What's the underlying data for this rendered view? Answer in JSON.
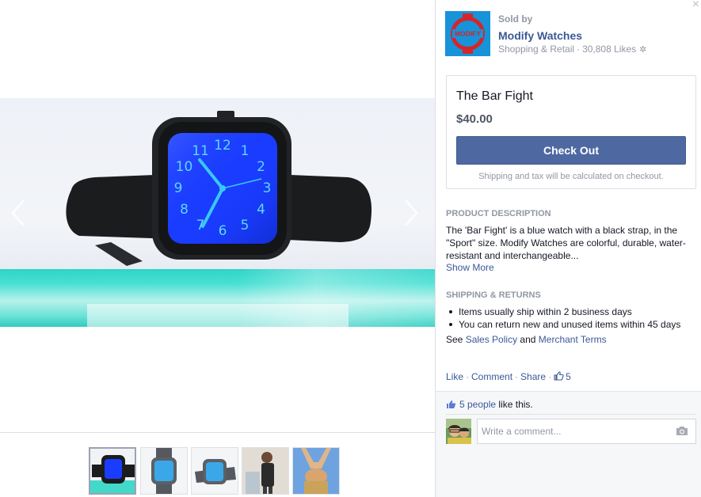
{
  "media": {
    "watch_numbers": [
      "12",
      "1",
      "2",
      "3",
      "4",
      "5",
      "6",
      "7",
      "8",
      "9",
      "10",
      "11"
    ],
    "thumbnails": [
      {
        "name": "thumb-black-watch",
        "active": true
      },
      {
        "name": "thumb-gray-watch-front",
        "active": false
      },
      {
        "name": "thumb-gray-watch-angle",
        "active": false
      },
      {
        "name": "thumb-person-lifestyle",
        "active": false
      },
      {
        "name": "thumb-person-sky",
        "active": false
      }
    ]
  },
  "close_symbol": "×",
  "seller": {
    "sold_by": "Sold by",
    "logo_text": "MODIFY",
    "name": "Modify Watches",
    "category": "Shopping & Retail",
    "separator": "·",
    "likes": "30,808 Likes",
    "settings_symbol": "✲"
  },
  "product": {
    "title": "The Bar Fight",
    "price": "$40.00",
    "checkout_label": "Check Out",
    "checkout_note": "Shipping and tax will be calculated on checkout."
  },
  "description": {
    "heading": "PRODUCT DESCRIPTION",
    "text": "The 'Bar Fight' is a blue watch with a black strap, in the \"Sport\" size. Modify Watches are colorful, durable, water-resistant and interchangeable...",
    "show_more": "Show More"
  },
  "shipping": {
    "heading": "SHIPPING & RETURNS",
    "items": [
      "Items usually ship within 2 business days",
      "You can return new and unused items within 45 days"
    ],
    "see": "See",
    "sales_policy": "Sales Policy",
    "and": "and",
    "merchant_terms": "Merchant Terms"
  },
  "actions": {
    "like": "Like",
    "comment": "Comment",
    "share": "Share",
    "dot": "·",
    "like_count": "5"
  },
  "ufi": {
    "likes_people": "5 people",
    "likes_suffix": "like this.",
    "comment_placeholder": "Write a comment..."
  },
  "colors": {
    "brand_blue": "#3b5998",
    "checkout_button": "#4e69a2",
    "watch_face": "#1a3cff",
    "watch_hands": "#39c8f0",
    "pedestal": "#3fd9cc",
    "logo_bg": "#1793d9",
    "logo_red": "#d3262a"
  }
}
